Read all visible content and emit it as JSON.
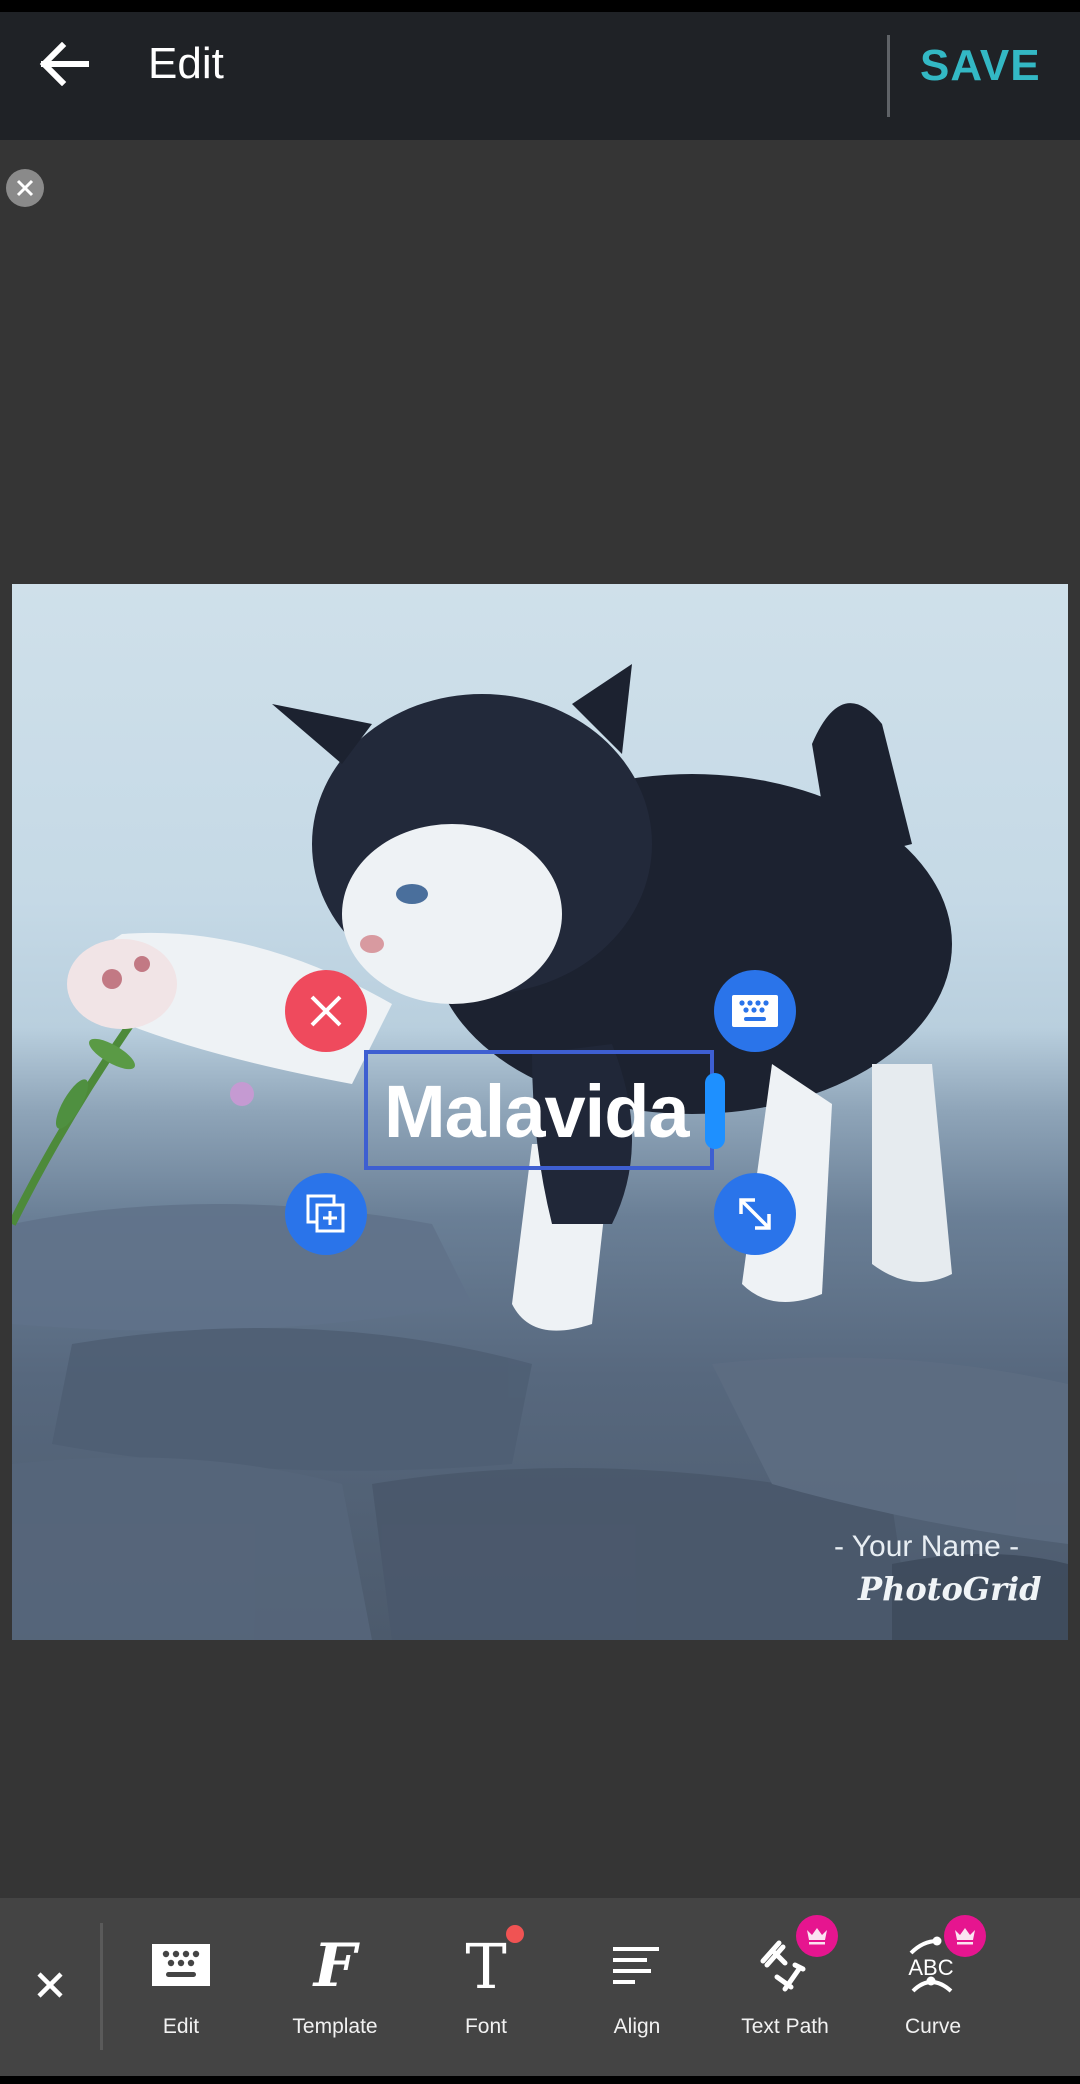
{
  "header": {
    "title": "Edit",
    "save_label": "SAVE",
    "back_icon": "arrow-left-icon"
  },
  "canvas": {
    "close_icon": "close-circle-icon",
    "photo_description": "Black-and-white kitten reaching toward a small pink flower on cobblestones",
    "watermark": {
      "name": "- Your Name -",
      "brand": "PhotoGrid"
    },
    "text_sticker": {
      "text": "Malavida",
      "controls": [
        {
          "id": "delete",
          "icon": "close-icon",
          "color": "#ef4a5d"
        },
        {
          "id": "keyboard",
          "icon": "keyboard-icon",
          "color": "#2a74ea"
        },
        {
          "id": "duplicate",
          "icon": "duplicate-icon",
          "color": "#2a74ea"
        },
        {
          "id": "resize",
          "icon": "resize-diagonal-icon",
          "color": "#2a74ea"
        }
      ],
      "border_color": "#3e5fd1",
      "cursor_color": "#1e90ff"
    }
  },
  "toolbar": {
    "close_icon": "close-icon",
    "tools": [
      {
        "label": "Edit",
        "icon": "keyboard-icon"
      },
      {
        "label": "Template",
        "icon": "script-f-icon"
      },
      {
        "label": "Font",
        "icon": "serif-t-icon",
        "badge": "new-dot"
      },
      {
        "label": "Align",
        "icon": "align-left-icon"
      },
      {
        "label": "Text Path",
        "icon": "text-path-icon",
        "badge": "premium-crown"
      },
      {
        "label": "Curve",
        "icon": "curve-text-icon",
        "badge": "premium-crown"
      },
      {
        "label": "",
        "icon": "partial-icon"
      }
    ]
  },
  "colors": {
    "accent": "#33b8c4",
    "premium": "#e6158f",
    "new_dot": "#f05353",
    "header_bg": "#1f2226",
    "toolbar_bg": "#444444",
    "canvas_bg": "#353535"
  }
}
